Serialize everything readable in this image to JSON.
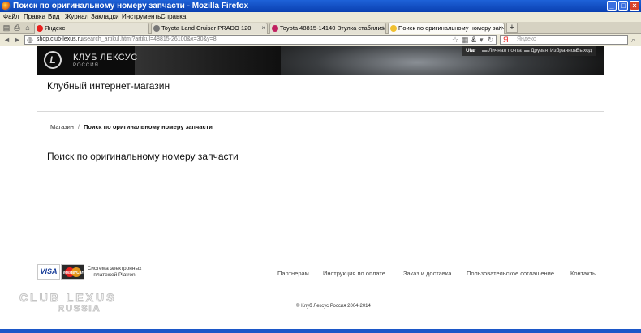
{
  "window": {
    "title": "Поиск по оригинальному номеру запчасти - Mozilla Firefox",
    "minimize": "_",
    "maximize": "□",
    "close": "×"
  },
  "menu": [
    "Файл",
    "Правка",
    "Вид",
    "Журнал",
    "Закладки",
    "Инструменты",
    "Справка"
  ],
  "tabs": [
    {
      "label": "Яндекс",
      "active": false,
      "icon_color": "#e8201e"
    },
    {
      "label": "Toyota Land Cruiser PRADO 120",
      "active": false,
      "icon_color": "#777777"
    },
    {
      "label": "Toyota 48815-14140 Втулка стабилиза...",
      "active": false,
      "icon_color": "#c02060"
    },
    {
      "label": "Поиск по оригинальному номеру запча...",
      "active": true,
      "icon_color": "#f0c030"
    }
  ],
  "tab_close": "×",
  "new_tab": "+",
  "nav": {
    "url_host": "shop.club-lexus.ru",
    "url_prefix": "",
    "url_rest": "/search_artikul.html?artikul=48815-26100&x=30&y=8",
    "search_placeholder": "Яндекс"
  },
  "site": {
    "club_name": "КЛУБ ЛЕКСУС",
    "club_country": "РОССИЯ",
    "logo_letter": "L",
    "user": {
      "name": "Ular",
      "links": [
        "Личная почта",
        "Друзья",
        "Избранное",
        "Выход"
      ]
    },
    "shop_title": "Клубный интернет-магазин",
    "breadcrumb": {
      "root": "Магазин",
      "separator": "/",
      "current": "Поиск по оригинальному номеру запчасти"
    },
    "heading": "Поиск по оригинальному номеру запчасти"
  },
  "footer": {
    "visa": "VISA",
    "mastercard": "MasterCard",
    "payment_text": "Система электронных платежей Platron",
    "links": [
      "Партнерам",
      "Инструкция по оплате",
      "Заказ и доставка",
      "Пользовательское соглашение",
      "Контакты"
    ],
    "club_logo": "CLUB LEXUS",
    "club_logo_sub": "RUSSIA",
    "copyright": "© Клуб Лексус Россия 2004-2014"
  },
  "colors": {
    "titlebar": "#1e62d8",
    "chrome": "#ece9d8",
    "banner": "#0c0c0c"
  }
}
